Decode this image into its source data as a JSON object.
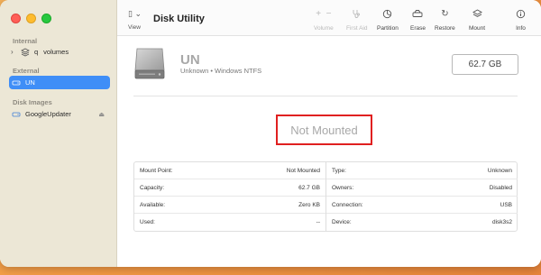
{
  "sidebar": {
    "section_internal": "Internal",
    "internal_items": [
      {
        "label": "volumes",
        "prefix": "q"
      }
    ],
    "section_external": "External",
    "external_items": [
      {
        "label": "UN"
      }
    ],
    "section_images": "Disk Images",
    "image_items": [
      {
        "label": "GoogleUpdater"
      }
    ]
  },
  "toolbar": {
    "view_label": "View",
    "title": "Disk Utility",
    "volume_label": "Volume",
    "first_aid_label": "First Aid",
    "partition_label": "Partition",
    "erase_label": "Erase",
    "restore_label": "Restore",
    "mount_label": "Mount",
    "info_label": "Info"
  },
  "disk": {
    "name": "UN",
    "subtitle": "Unknown • Windows NTFS",
    "capacity": "62.7 GB",
    "status": "Not Mounted"
  },
  "details": {
    "left": [
      {
        "key": "Mount Point:",
        "value": "Not Mounted"
      },
      {
        "key": "Capacity:",
        "value": "62.7 GB"
      },
      {
        "key": "Available:",
        "value": "Zero KB"
      },
      {
        "key": "Used:",
        "value": "--"
      }
    ],
    "right": [
      {
        "key": "Type:",
        "value": "Unknown"
      },
      {
        "key": "Owners:",
        "value": "Disabled"
      },
      {
        "key": "Connection:",
        "value": "USB"
      },
      {
        "key": "Device:",
        "value": "disk3s2"
      }
    ]
  },
  "colors": {
    "accent": "#3f8ef7",
    "highlight_border": "#e02020"
  }
}
